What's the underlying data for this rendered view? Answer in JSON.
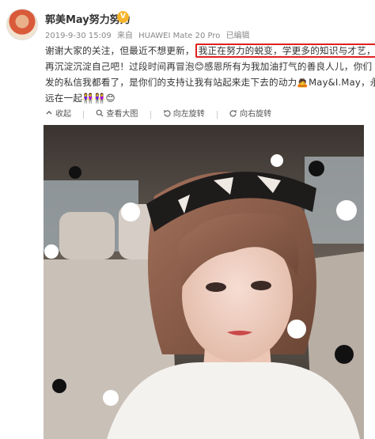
{
  "user": {
    "name": "郭美May努力努力",
    "badge": "V"
  },
  "post": {
    "date": "2019-9-30 15:09",
    "source_prefix": "来自",
    "device": "HUAWEI Mate 20 Pro",
    "status": "已编辑",
    "text_line1_before": "谢谢大家的关注，但最近不想更新，",
    "text_highlight": "我正在努力的蜕变，学更多的知识与才艺，",
    "text_line2": "再沉淀沉淀自己吧！过段时间再冒泡😊感恩所有为我加油打气的善良人儿，你们",
    "text_line3": "发的私信我都看了，是你们的支持让我有站起来走下去的动力🙇May&I.May，永",
    "text_line4": "远在一起👭👭😊"
  },
  "toolbar": {
    "collapse": "收起",
    "view_large": "查看大图",
    "rotate_left": "向左旋转",
    "rotate_right": "向右旋转"
  },
  "colors": {
    "highlight_border": "#e02020",
    "meta_text": "#888888",
    "badge": "#f7b52c"
  }
}
